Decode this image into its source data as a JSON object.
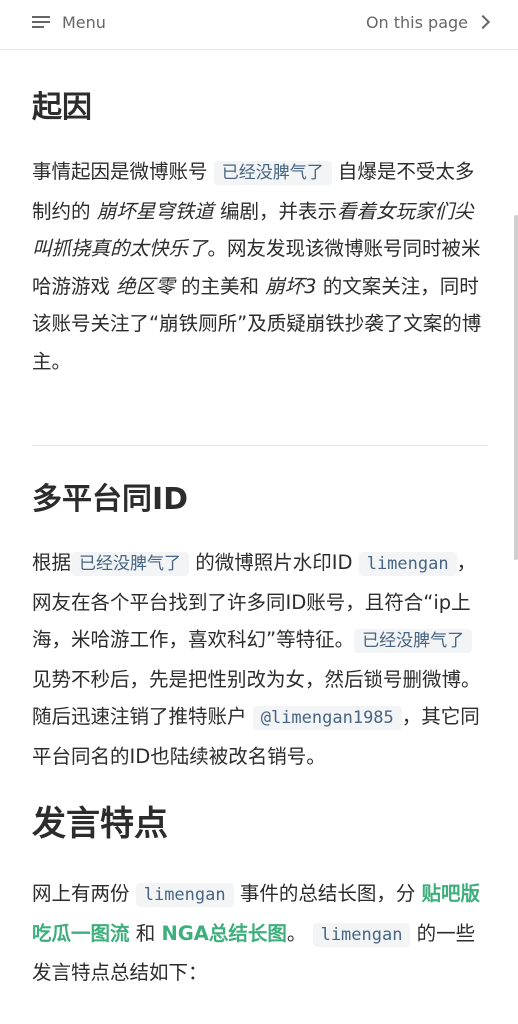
{
  "topbar": {
    "menu_label": "Menu",
    "toc_label": "On this page"
  },
  "section1": {
    "title": "起因",
    "t1": "事情起因是微博账号",
    "code1": "已经没脾气了",
    "t2": "自爆是不受太多制约的",
    "em1": "崩坏星穹铁道",
    "t3": "编剧，并表示",
    "em2": "看着女玩家们尖叫抓挠真的太快乐了",
    "t4": "。网友发现该微博账号同时被米哈游游戏",
    "em3": "绝区零",
    "t5": "的主美和",
    "em4": "崩坏3",
    "t6": "的文案关注，同时该账号关注了“崩铁厕所”及质疑崩铁抄袭了文案的博主。"
  },
  "section2": {
    "title": "多平台同ID",
    "t1": "根据",
    "code1": "已经没脾气了",
    "t2": "的微博照片水印ID",
    "code2": "limengan",
    "t3": "，网友在各个平台找到了许多同ID账号，且符合“ip上海，米哈游工作，喜欢科幻”等特征。",
    "code3": "已经没脾气了",
    "t4": "见势不秒后，先是把性别改为女，然后锁号删微博。随后迅速注销了推特账户",
    "code4": "@limengan1985",
    "t5": "，其它同平台同名的ID也陆续被改名销号。"
  },
  "section3": {
    "title": "发言特点",
    "t1": "网上有两份",
    "code1": "limengan",
    "t2": "事件的总结长图，分",
    "link1": "贴吧版吃瓜一图流",
    "t3": "和",
    "link2": "NGA总结长图",
    "t4": "。",
    "code2": "limengan",
    "t5": "的一些发言特点总结如下："
  }
}
